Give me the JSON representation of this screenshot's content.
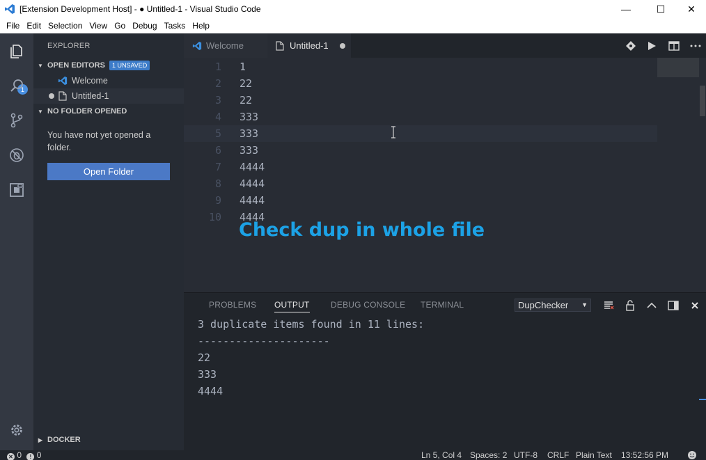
{
  "window": {
    "title": "[Extension Development Host] - ● Untitled-1 - Visual Studio Code",
    "minimize_glyph": "—",
    "maximize_glyph": "☐",
    "close_glyph": "✕"
  },
  "menu": [
    "File",
    "Edit",
    "Selection",
    "View",
    "Go",
    "Debug",
    "Tasks",
    "Help"
  ],
  "activity_bar": {
    "icons": [
      "files-icon",
      "search-icon",
      "source-control-icon",
      "debug-icon",
      "extensions-icon",
      "gear-icon"
    ],
    "explorer_badge": "1"
  },
  "sidebar": {
    "title": "EXPLORER",
    "open_editors_header": "OPEN EDITORS",
    "unsaved_badge": "1 UNSAVED",
    "open_editors": [
      {
        "label": "Welcome",
        "icon": "vscode-icon",
        "dirty": false
      },
      {
        "label": "Untitled-1",
        "icon": "file-icon",
        "dirty": true
      }
    ],
    "no_folder_header": "NO FOLDER OPENED",
    "no_folder_message": "You have not yet opened a folder.",
    "open_folder_button": "Open Folder",
    "docker_header": "DOCKER"
  },
  "tabs": [
    {
      "label": "Welcome",
      "active": false,
      "dirty": false
    },
    {
      "label": "Untitled-1",
      "active": true,
      "dirty": true
    }
  ],
  "editor": {
    "lines": [
      {
        "num": "1",
        "text": "1"
      },
      {
        "num": "2",
        "text": "22"
      },
      {
        "num": "3",
        "text": "22"
      },
      {
        "num": "4",
        "text": "333"
      },
      {
        "num": "5",
        "text": "333"
      },
      {
        "num": "6",
        "text": "333"
      },
      {
        "num": "7",
        "text": "4444"
      },
      {
        "num": "8",
        "text": "4444"
      },
      {
        "num": "9",
        "text": "4444"
      },
      {
        "num": "10",
        "text": "4444"
      }
    ],
    "current_line": 5,
    "caption": "Check dup in whole file"
  },
  "panel": {
    "tabs": [
      "PROBLEMS",
      "OUTPUT",
      "DEBUG CONSOLE",
      "TERMINAL"
    ],
    "active_tab": "OUTPUT",
    "output_channel": "DupChecker",
    "output_lines": [
      "3 duplicate items found in 11 lines:",
      "---------------------",
      "22",
      "333",
      "4444"
    ]
  },
  "status_bar": {
    "errors": "0",
    "warnings": "0",
    "position": "Ln 5, Col 4",
    "spaces": "Spaces: 2",
    "encoding": "UTF-8",
    "eol": "CRLF",
    "language": "Plain Text",
    "time": "13:52:56 PM"
  },
  "colors": {
    "caption": "#1ca2e6",
    "open_folder_button": "#4b79c6",
    "badge": "#4a90e2"
  }
}
